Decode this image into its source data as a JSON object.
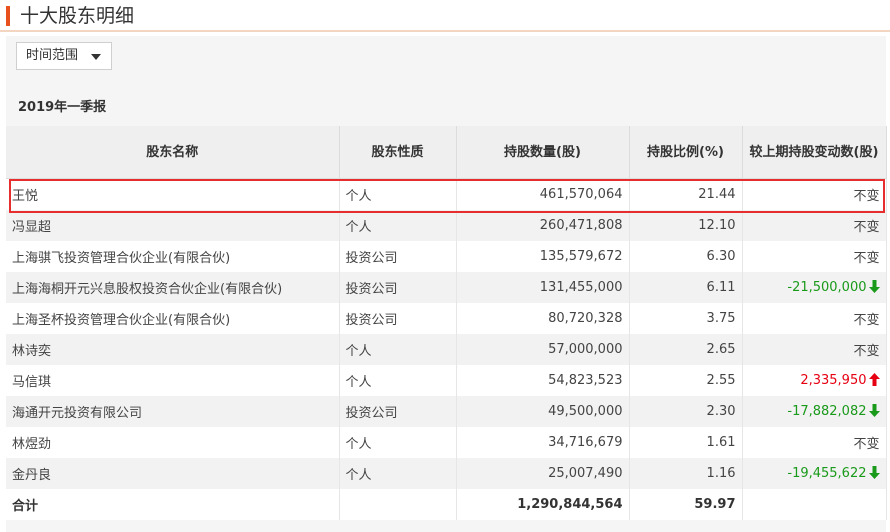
{
  "header": {
    "title": "十大股东明细"
  },
  "filter": {
    "range_label": "时间范围"
  },
  "period": "2019年一季报",
  "table": {
    "columns": [
      "股东名称",
      "股东性质",
      "持股数量(股)",
      "持股比例(%)",
      "较上期持股变动数(股)"
    ],
    "rows": [
      {
        "name": "王悦",
        "type": "个人",
        "shares": "461,570,064",
        "ratio": "21.44",
        "change": "不变",
        "dir": "none"
      },
      {
        "name": "冯显超",
        "type": "个人",
        "shares": "260,471,808",
        "ratio": "12.10",
        "change": "不变",
        "dir": "none"
      },
      {
        "name": "上海骐飞投资管理合伙企业(有限合伙)",
        "type": "投资公司",
        "shares": "135,579,672",
        "ratio": "6.30",
        "change": "不变",
        "dir": "none"
      },
      {
        "name": "上海海桐开元兴息股权投资合伙企业(有限合伙)",
        "type": "投资公司",
        "shares": "131,455,000",
        "ratio": "6.11",
        "change": "-21,500,000",
        "dir": "down"
      },
      {
        "name": "上海圣杯投资管理合伙企业(有限合伙)",
        "type": "投资公司",
        "shares": "80,720,328",
        "ratio": "3.75",
        "change": "不变",
        "dir": "none"
      },
      {
        "name": "林诗奕",
        "type": "个人",
        "shares": "57,000,000",
        "ratio": "2.65",
        "change": "不变",
        "dir": "none"
      },
      {
        "name": "马信琪",
        "type": "个人",
        "shares": "54,823,523",
        "ratio": "2.55",
        "change": "2,335,950",
        "dir": "up"
      },
      {
        "name": "海通开元投资有限公司",
        "type": "投资公司",
        "shares": "49,500,000",
        "ratio": "2.30",
        "change": "-17,882,082",
        "dir": "down"
      },
      {
        "name": "林煜劲",
        "type": "个人",
        "shares": "34,716,679",
        "ratio": "1.61",
        "change": "不变",
        "dir": "none"
      },
      {
        "name": "金丹良",
        "type": "个人",
        "shares": "25,007,490",
        "ratio": "1.16",
        "change": "-19,455,622",
        "dir": "down"
      }
    ],
    "total": {
      "label": "合计",
      "shares": "1,290,844,564",
      "ratio": "59.97"
    }
  },
  "colors": {
    "accent": "#e8501e",
    "highlight": "#e62e2e",
    "up": "#e60012",
    "down": "#1a9a1a"
  },
  "icons": {
    "up": "arrow-up-icon",
    "down": "arrow-down-icon",
    "dropdown": "caret-down-icon"
  }
}
